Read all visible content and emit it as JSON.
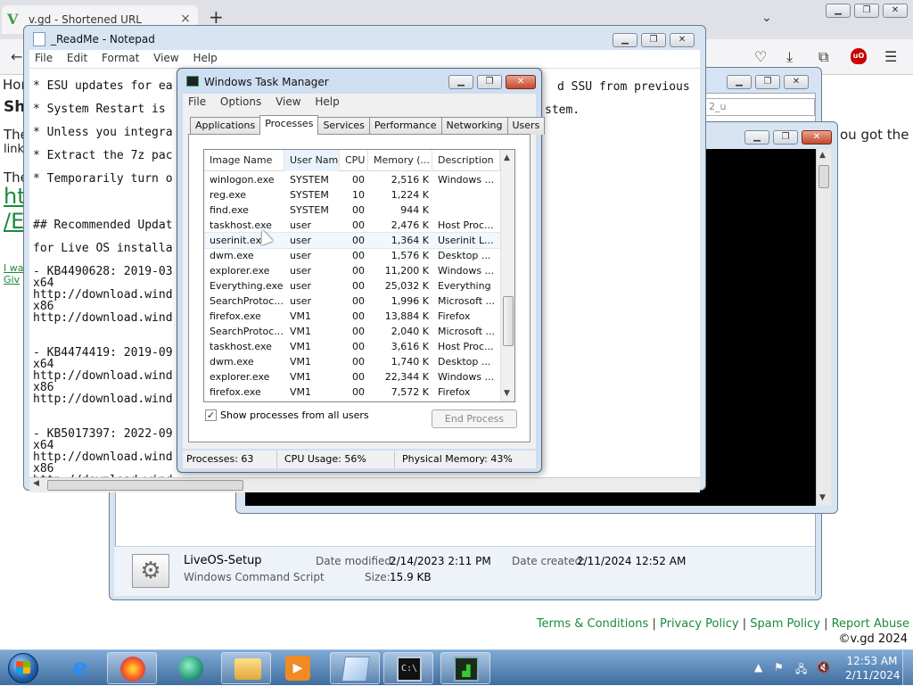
{
  "firefox": {
    "tab_title": "v.gd - Shortened URL",
    "tab_close": "×",
    "new_tab": "+",
    "tab_list": "⌄",
    "back": "←",
    "colors": {
      "link": "#1a8a3a"
    },
    "page": {
      "left_fragments": [
        "Hor",
        "Sh",
        "The",
        "link",
        "The",
        "ht",
        "/E"
      ],
      "small_links": [
        "I wa",
        "Giv"
      ],
      "right_fragments": [
        "ou got the"
      ],
      "footer": {
        "terms": "Terms & Conditions",
        "privacy": "Privacy Policy",
        "spam": "Spam Policy",
        "abuse": "Report Abuse",
        "sep": "|",
        "copyright": "©v.gd 2024"
      }
    }
  },
  "explorer": {
    "search_placeholder": "2_u",
    "details": {
      "name": "LiveOS-Setup",
      "type": "Windows Command Script",
      "modified_label": "Date modified:",
      "modified_value": "2/14/2023 2:11 PM",
      "size_label": "Size:",
      "size_value": "15.9 KB",
      "created_label": "Date created:",
      "created_value": "2/11/2024 12:52 AM"
    }
  },
  "notepad": {
    "title": "_ReadMe - Notepad",
    "menu": [
      "File",
      "Edit",
      "Format",
      "View",
      "Help"
    ],
    "lines": [
      "* ESU updates for ea",
      "* System Restart is",
      "* Unless you integra",
      "* Extract the 7z pac",
      "* Temporarily turn o",
      "",
      "## Recommended Updat",
      "for Live OS installa",
      "- KB4490628: 2019-03",
      "x64",
      "http://download.wind",
      "x86",
      "http://download.wind",
      "",
      "- KB4474419: 2019-09",
      "x64",
      "http://download.wind",
      "x86",
      "http://download.wind",
      "",
      "- KB5017397: 2022-09",
      "x64",
      "http://download.wind",
      "x86",
      "http://download.wind"
    ],
    "right_fragments": [
      "d SSU from previous",
      "stem."
    ]
  },
  "taskmgr": {
    "title": "Windows Task Manager",
    "menu": [
      "File",
      "Options",
      "View",
      "Help"
    ],
    "tabs": [
      "Applications",
      "Processes",
      "Services",
      "Performance",
      "Networking",
      "Users"
    ],
    "columns": [
      "Image Name",
      "User Name",
      "CPU",
      "Memory (...",
      "Description"
    ],
    "rows": [
      [
        "winlogon.exe",
        "SYSTEM",
        "00",
        "2,516 K",
        "Windows ..."
      ],
      [
        "reg.exe",
        "SYSTEM",
        "10",
        "1,224 K",
        ""
      ],
      [
        "find.exe",
        "SYSTEM",
        "00",
        "944 K",
        ""
      ],
      [
        "taskhost.exe",
        "user",
        "00",
        "2,476 K",
        "Host Proc..."
      ],
      [
        "userinit.exe",
        "user",
        "00",
        "1,364 K",
        "Userinit L..."
      ],
      [
        "dwm.exe",
        "user",
        "00",
        "1,576 K",
        "Desktop ..."
      ],
      [
        "explorer.exe",
        "user",
        "00",
        "11,200 K",
        "Windows ..."
      ],
      [
        "Everything.exe",
        "user",
        "00",
        "25,032 K",
        "Everything"
      ],
      [
        "SearchProtoc...",
        "user",
        "00",
        "1,996 K",
        "Microsoft ..."
      ],
      [
        "firefox.exe",
        "VM1",
        "00",
        "13,884 K",
        "Firefox"
      ],
      [
        "SearchProtoc...",
        "VM1",
        "00",
        "2,040 K",
        "Microsoft ..."
      ],
      [
        "taskhost.exe",
        "VM1",
        "00",
        "3,616 K",
        "Host Proc..."
      ],
      [
        "dwm.exe",
        "VM1",
        "00",
        "1,740 K",
        "Desktop ..."
      ],
      [
        "explorer.exe",
        "VM1",
        "00",
        "22,344 K",
        "Windows ..."
      ],
      [
        "firefox.exe",
        "VM1",
        "00",
        "7,572 K",
        "Firefox"
      ]
    ],
    "show_all_label": "Show processes from all users",
    "show_all_checked": "✓",
    "end_process": "End Process",
    "status": {
      "processes": "Processes: 63",
      "cpu": "CPU Usage: 56%",
      "memory": "Physical Memory: 43%"
    }
  },
  "taskbar": {
    "clock_time": "12:53 AM",
    "clock_date": "2/11/2024"
  }
}
